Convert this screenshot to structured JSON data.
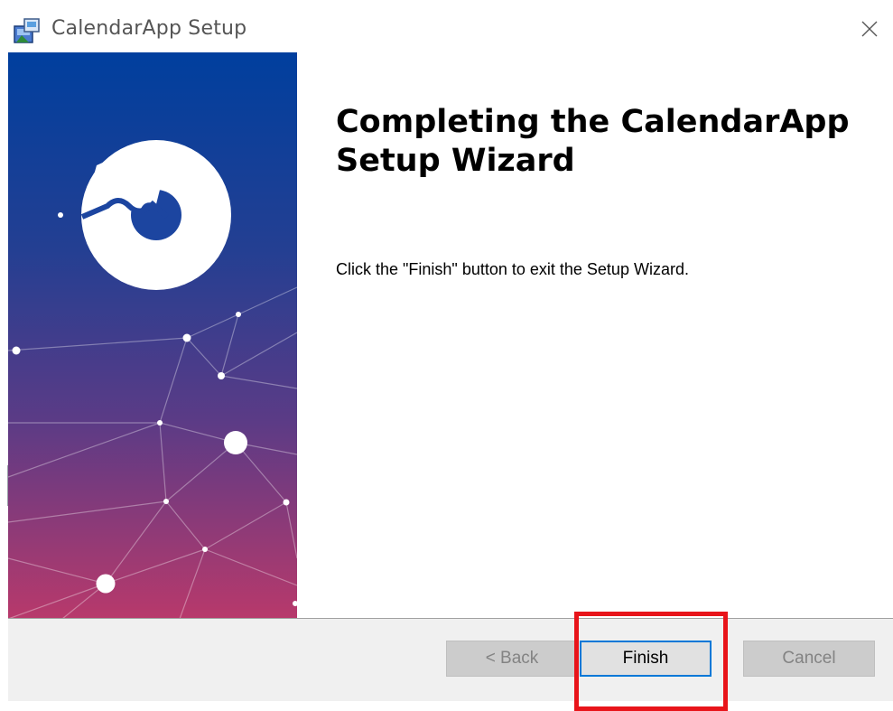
{
  "window": {
    "title": "CalendarApp Setup",
    "icons": {
      "app": "installer-icon",
      "close": "close-icon"
    }
  },
  "content": {
    "heading": "Completing the CalendarApp Setup Wizard",
    "message": "Click the \"Finish\" button to exit the Setup Wizard."
  },
  "buttons": {
    "back": {
      "label": "< Back",
      "enabled": false
    },
    "finish": {
      "label": "Finish",
      "enabled": true,
      "focused": true
    },
    "cancel": {
      "label": "Cancel",
      "enabled": false
    }
  },
  "colors": {
    "banner_top": "#003f9e",
    "banner_bottom": "#b8396b",
    "focus_border": "#0078d7",
    "highlight": "#e8141a"
  }
}
